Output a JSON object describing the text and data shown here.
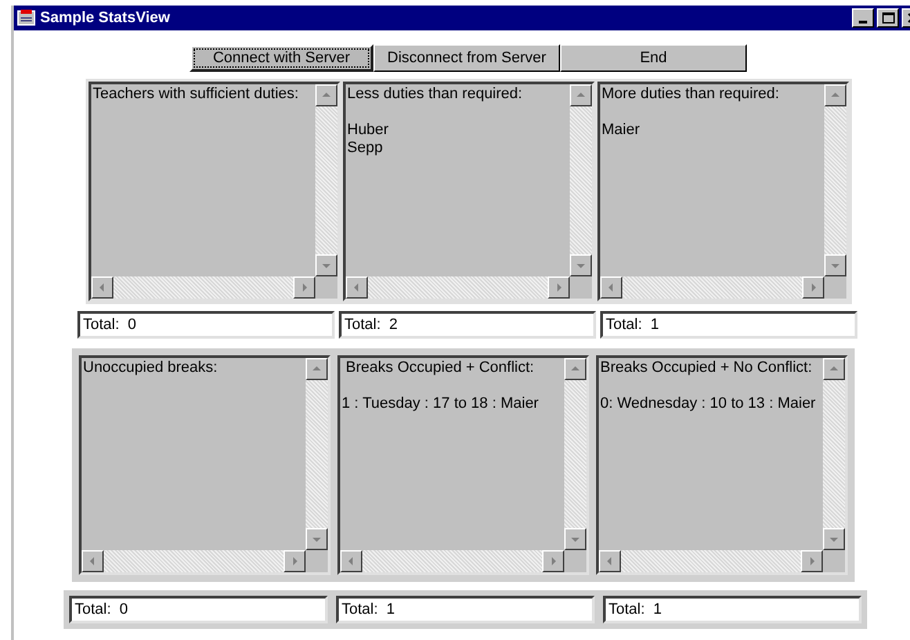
{
  "window": {
    "title": "Sample StatsView"
  },
  "buttons": [
    {
      "label": "Connect with Server",
      "focused": true
    },
    {
      "label": "Disconnect from Server",
      "focused": false
    },
    {
      "label": "End",
      "focused": false
    }
  ],
  "duty_lists": [
    {
      "title": "Teachers with sufficient duties:"
    },
    {
      "title": "Less duties than required:",
      "items": [
        "Huber",
        "Sepp"
      ]
    },
    {
      "title": "More duties than required:",
      "items": [
        "Maier"
      ]
    }
  ],
  "duty_totals": [
    "Total:  0",
    "Total:  2",
    "Total:  1"
  ],
  "break_lists": [
    {
      "title": "Unoccupied breaks:"
    },
    {
      "title": " Breaks Occupied + Conflict:",
      "items": [
        "1 : Tuesday : 17 to 18 : Maier"
      ]
    },
    {
      "title": "Breaks Occupied + No Conflict:",
      "items": [
        "0: Wednesday : 10 to 13 : Maier"
      ]
    }
  ],
  "break_totals": [
    "Total:  0",
    "Total:  1",
    "Total:  1"
  ]
}
